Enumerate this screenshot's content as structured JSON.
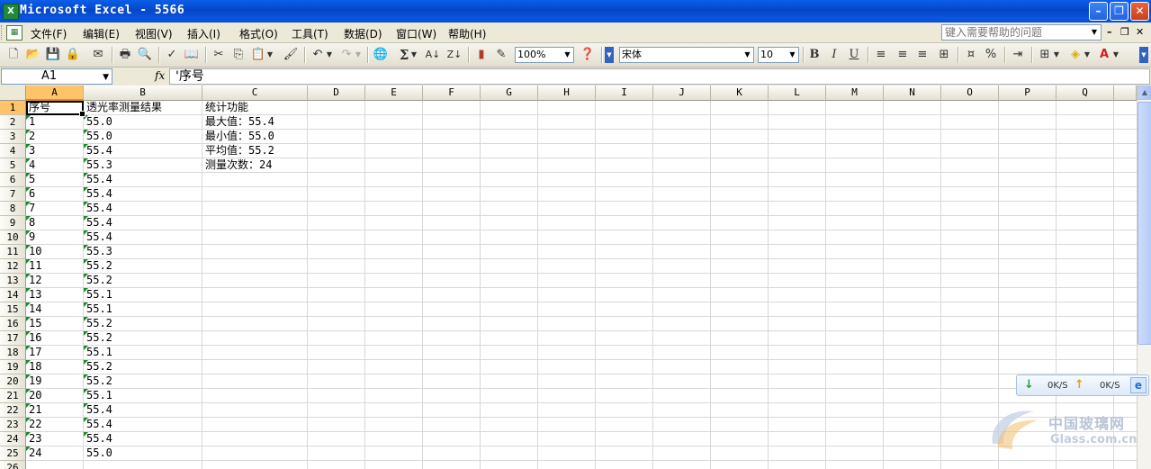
{
  "window": {
    "title": "Microsoft Excel - 5566",
    "app_icon": "excel-icon",
    "buttons": [
      "minimize",
      "restore",
      "close"
    ]
  },
  "menu": {
    "items": [
      "文件(F)",
      "编辑(E)",
      "视图(V)",
      "插入(I)",
      "格式(O)",
      "工具(T)",
      "数据(D)",
      "窗口(W)",
      "帮助(H)"
    ],
    "help_placeholder": "键入需要帮助的问题"
  },
  "toolbar": {
    "zoom": "100%",
    "font": "宋体",
    "size": "10",
    "bold": "B",
    "italic": "I",
    "underline": "U",
    "percent": "%",
    "sum": "Σ"
  },
  "formula_bar": {
    "name_box": "A1",
    "fx": "fx",
    "content": "'序号"
  },
  "sheet": {
    "columns": [
      "A",
      "B",
      "C",
      "D",
      "E",
      "F",
      "G",
      "H",
      "I",
      "J",
      "K",
      "L",
      "M",
      "N",
      "O",
      "P",
      "Q"
    ],
    "row_numbers": [
      "1",
      "2",
      "3",
      "4",
      "5",
      "6",
      "7",
      "8",
      "9",
      "10",
      "11",
      "12",
      "13",
      "14",
      "15",
      "16",
      "17",
      "18",
      "19",
      "20",
      "21",
      "22",
      "23",
      "24",
      "25",
      "26"
    ],
    "colA": [
      "序号",
      "1",
      "2",
      "3",
      "4",
      "5",
      "6",
      "7",
      "8",
      "9",
      "10",
      "11",
      "12",
      "13",
      "14",
      "15",
      "16",
      "17",
      "18",
      "19",
      "20",
      "21",
      "22",
      "23",
      "24"
    ],
    "colB": [
      "透光率测量结果",
      "55.0",
      "55.0",
      "55.4",
      "55.3",
      "55.4",
      "55.4",
      "55.4",
      "55.4",
      "55.4",
      "55.3",
      "55.2",
      "55.2",
      "55.1",
      "55.1",
      "55.2",
      "55.2",
      "55.1",
      "55.2",
      "55.2",
      "55.1",
      "55.4",
      "55.4",
      "55.4",
      "55.0"
    ],
    "colC": [
      "统计功能",
      "最大值：55.4",
      "最小值：55.0",
      "平均值：55.2",
      "测量次数：24"
    ]
  },
  "net_widget": {
    "down": "0K/S",
    "up": "0K/S"
  },
  "watermark": {
    "cn": "中国玻璃网",
    "en": "Glass.com.cn"
  }
}
